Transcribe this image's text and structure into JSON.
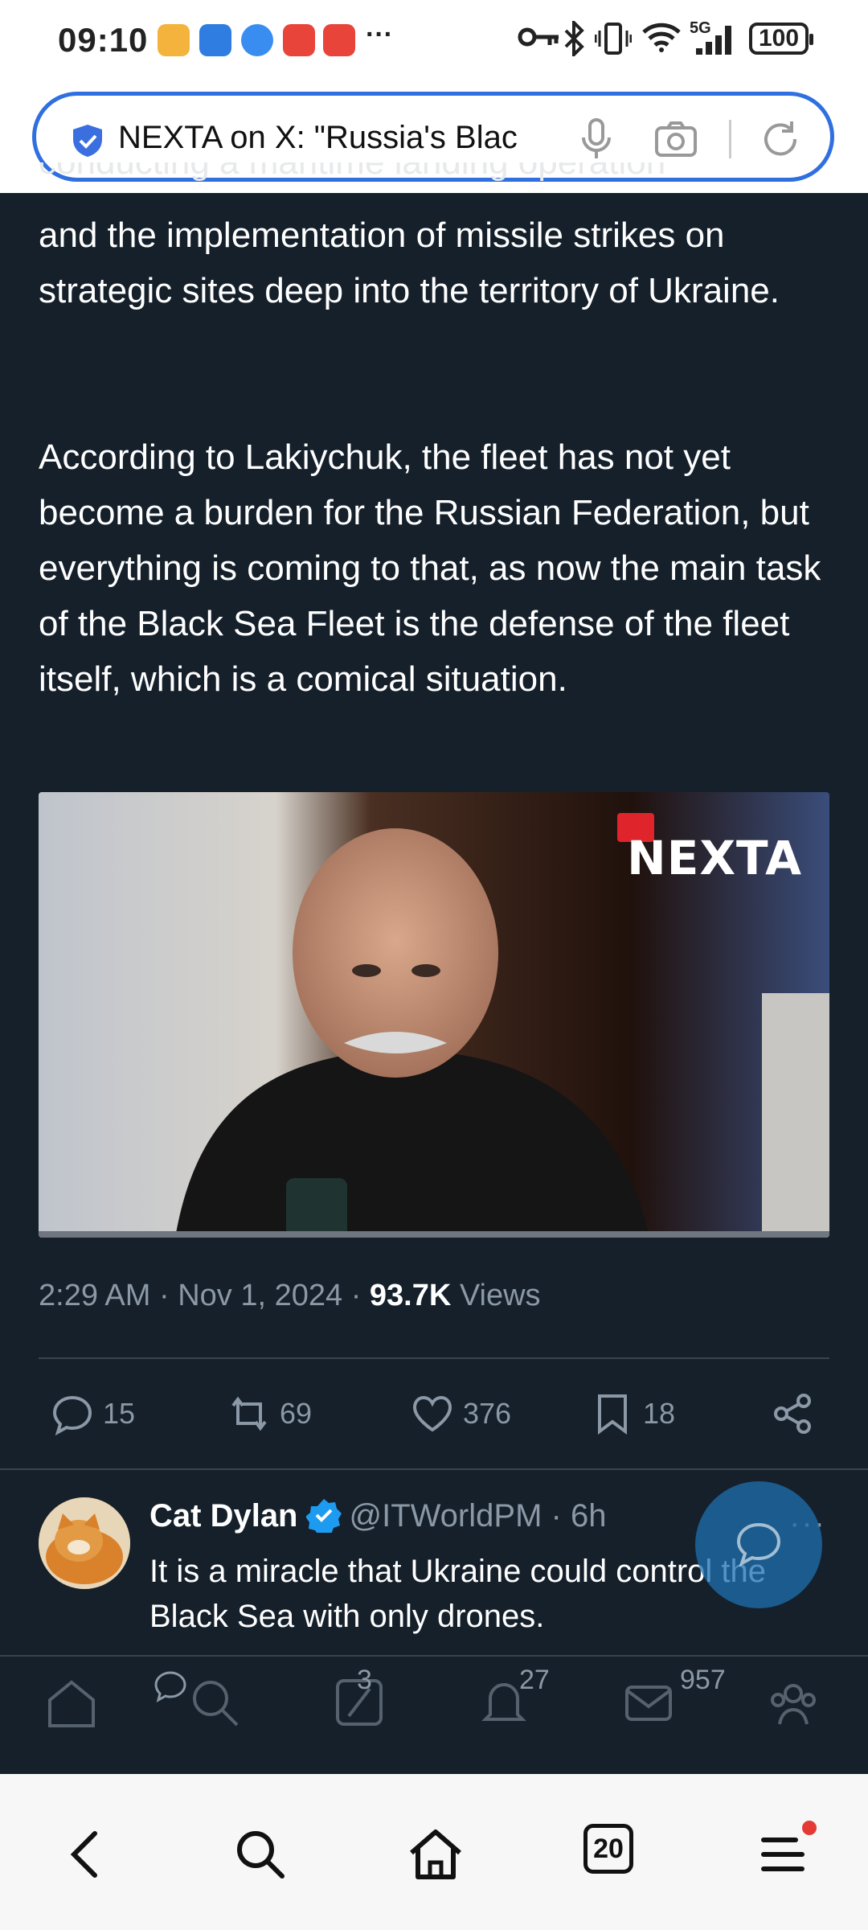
{
  "status_bar": {
    "time": "09:10",
    "overflow": "···",
    "battery": "100",
    "network": "5G"
  },
  "browser": {
    "page_title": "NEXTA on X: \"Russia's Blac",
    "tab_count": "20"
  },
  "tweet": {
    "cut_line": "conducting a maritime landing operation",
    "paragraph1": "and the implementation of missile strikes on strategic sites deep into the territory of Ukraine.",
    "paragraph2": "According to Lakiychuk, the fleet has not yet become a burden for the Russian Federation, but everything is coming to that, as now the main task of the Black Sea Fleet is the defense of the fleet itself, which is a comical situation.",
    "media_logo": "NEXTA",
    "time": "2:29 AM",
    "date": "Nov 1, 2024",
    "sep": "·",
    "views_count": "93.7K",
    "views_label": "Views",
    "replies": "15",
    "reposts": "69",
    "likes": "376",
    "bookmarks": "18"
  },
  "reply": {
    "name": "Cat Dylan",
    "handle": "@ITWorldPM",
    "age": "· 6h",
    "text": "It is a miracle that Ukraine could control the Black Sea with only drones.",
    "more": "···",
    "reposts": "3",
    "likes": "27",
    "views": "957"
  },
  "colors": {
    "background": "#15202b",
    "muted": "#8b98a5",
    "accent": "#1d9bf0",
    "address_border": "#2f6fe0"
  }
}
